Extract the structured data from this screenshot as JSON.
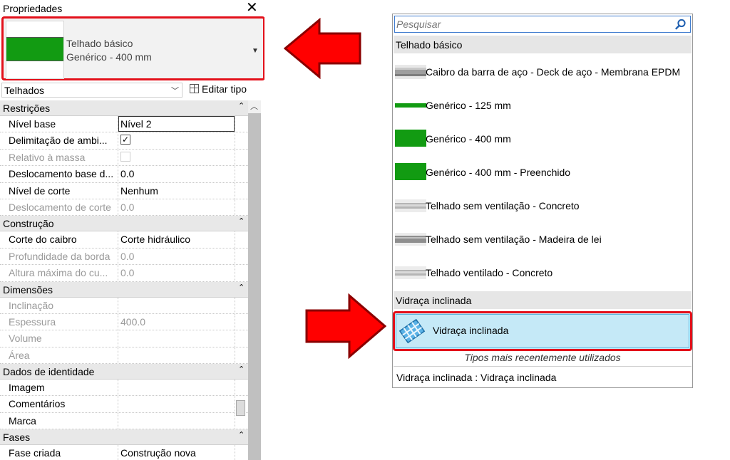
{
  "palette": {
    "title": "Propriedades",
    "close_glyph": "✕",
    "type_selector": {
      "family": "Telhado básico",
      "type": "Genérico - 400 mm",
      "swatch_color": "#129b12"
    },
    "category": "Telhados",
    "edit_type_label": "Editar tipo",
    "groups": [
      {
        "label": "Restrições",
        "rows": [
          {
            "key": "Nível base",
            "value": "Nível 2",
            "disabled": false,
            "boxed": true
          },
          {
            "key": "Delimitação de ambi...",
            "value": "",
            "checkbox": true,
            "checked": true,
            "disabled": false
          },
          {
            "key": "Relativo à massa",
            "value": "",
            "checkbox": true,
            "checked": false,
            "disabled": true
          },
          {
            "key": "Deslocamento base d...",
            "value": "0.0",
            "disabled": false
          },
          {
            "key": "Nível de corte",
            "value": "Nenhum",
            "disabled": false
          },
          {
            "key": "Deslocamento de corte",
            "value": "0.0",
            "disabled": true
          }
        ]
      },
      {
        "label": "Construção",
        "rows": [
          {
            "key": "Corte do caibro",
            "value": "Corte hidráulico",
            "disabled": false
          },
          {
            "key": "Profundidade da borda",
            "value": "0.0",
            "disabled": true
          },
          {
            "key": "Altura máxima do cu...",
            "value": "0.0",
            "disabled": true
          }
        ]
      },
      {
        "label": "Dimensões",
        "rows": [
          {
            "key": "Inclinação",
            "value": "",
            "disabled": true
          },
          {
            "key": "Espessura",
            "value": "400.0",
            "disabled": true
          },
          {
            "key": "Volume",
            "value": "",
            "disabled": true
          },
          {
            "key": "Área",
            "value": "",
            "disabled": true
          }
        ]
      },
      {
        "label": "Dados de identidade",
        "rows": [
          {
            "key": "Imagem",
            "value": "",
            "disabled": false
          },
          {
            "key": "Comentários",
            "value": "",
            "disabled": false
          },
          {
            "key": "Marca",
            "value": "",
            "disabled": false
          }
        ]
      },
      {
        "label": "Fases",
        "rows": [
          {
            "key": "Fase criada",
            "value": "Construção nova",
            "disabled": false
          }
        ]
      }
    ]
  },
  "dropdown": {
    "search_placeholder": "Pesquisar",
    "groups": [
      {
        "label": "Telhado básico",
        "items": [
          {
            "label": "Caibro da barra de aço - Deck de aço - Membrana EPDM",
            "swatch": "steel"
          },
          {
            "label": "Genérico - 125 mm",
            "swatch": "green-thin"
          },
          {
            "label": "Genérico - 400 mm",
            "swatch": "green-thick"
          },
          {
            "label": "Genérico - 400 mm - Preenchido",
            "swatch": "green-thick"
          },
          {
            "label": "Telhado sem ventilação - Concreto",
            "swatch": "concrete"
          },
          {
            "label": "Telhado sem ventilação - Madeira de lei",
            "swatch": "wood"
          },
          {
            "label": "Telhado ventilado - Concreto",
            "swatch": "concrete"
          }
        ]
      },
      {
        "label": "Vidraça inclinada",
        "items": [
          {
            "label": "Vidraça inclinada",
            "swatch": "glazing-icon",
            "selected": true
          }
        ]
      }
    ],
    "recent_header": "Tipos mais recentemente utilizados",
    "recent_items": [
      "Vidraça inclinada : Vidraça inclinada"
    ]
  },
  "colors": {
    "highlight_red": "#e3101a",
    "arrow_red": "#ff0000",
    "selection_blue": "#c5e9f7",
    "green": "#129b12"
  }
}
